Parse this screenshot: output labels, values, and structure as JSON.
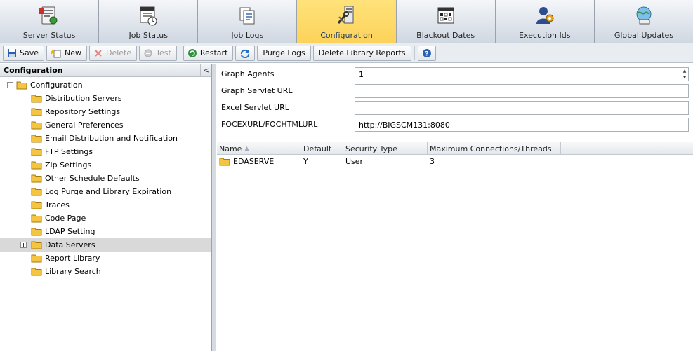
{
  "tabs": [
    {
      "key": "server-status",
      "label": "Server Status",
      "icon": "server-status-icon",
      "active": false
    },
    {
      "key": "job-status",
      "label": "Job Status",
      "icon": "job-status-icon",
      "active": false
    },
    {
      "key": "job-logs",
      "label": "Job Logs",
      "icon": "job-logs-icon",
      "active": false
    },
    {
      "key": "configuration",
      "label": "Configuration",
      "icon": "configuration-icon",
      "active": true
    },
    {
      "key": "blackout-dates",
      "label": "Blackout Dates",
      "icon": "calendar-icon",
      "active": false
    },
    {
      "key": "execution-ids",
      "label": "Execution Ids",
      "icon": "execution-ids-icon",
      "active": false
    },
    {
      "key": "global-updates",
      "label": "Global Updates",
      "icon": "global-updates-icon",
      "active": false
    }
  ],
  "toolbar": {
    "save": "Save",
    "new": "New",
    "delete": "Delete",
    "test": "Test",
    "restart": "Restart",
    "purge_logs": "Purge Logs",
    "delete_library_reports": "Delete Library Reports"
  },
  "left_panel": {
    "title": "Configuration",
    "collapse_glyph": "<",
    "root": "Configuration",
    "items": [
      "Distribution Servers",
      "Repository Settings",
      "General Preferences",
      "Email Distribution and Notification",
      "FTP Settings",
      "Zip Settings",
      "Other Schedule Defaults",
      "Log Purge and Library Expiration",
      "Traces",
      "Code Page",
      "LDAP Setting",
      "Data Servers",
      "Report Library",
      "Library Search"
    ],
    "selected_item": "Data Servers"
  },
  "form": {
    "graph_agents": {
      "label": "Graph Agents",
      "value": "1"
    },
    "graph_servlet_url": {
      "label": "Graph Servlet URL",
      "value": ""
    },
    "excel_servlet_url": {
      "label": "Excel Servlet URL",
      "value": ""
    },
    "focexurl": {
      "label": "FOCEXURL/FOCHTMLURL",
      "value": "http://BIGSCM131:8080"
    }
  },
  "grid": {
    "columns": [
      "Name",
      "Default",
      "Security Type",
      "Maximum Connections/Threads"
    ],
    "rows": [
      {
        "name": "EDASERVE",
        "default": "Y",
        "security_type": "User",
        "max_connections": "3"
      }
    ]
  },
  "colors": {
    "active_tab": "#fcd35a",
    "selected_tree_row": "#d9d9d9",
    "folder": "#f5c542"
  }
}
